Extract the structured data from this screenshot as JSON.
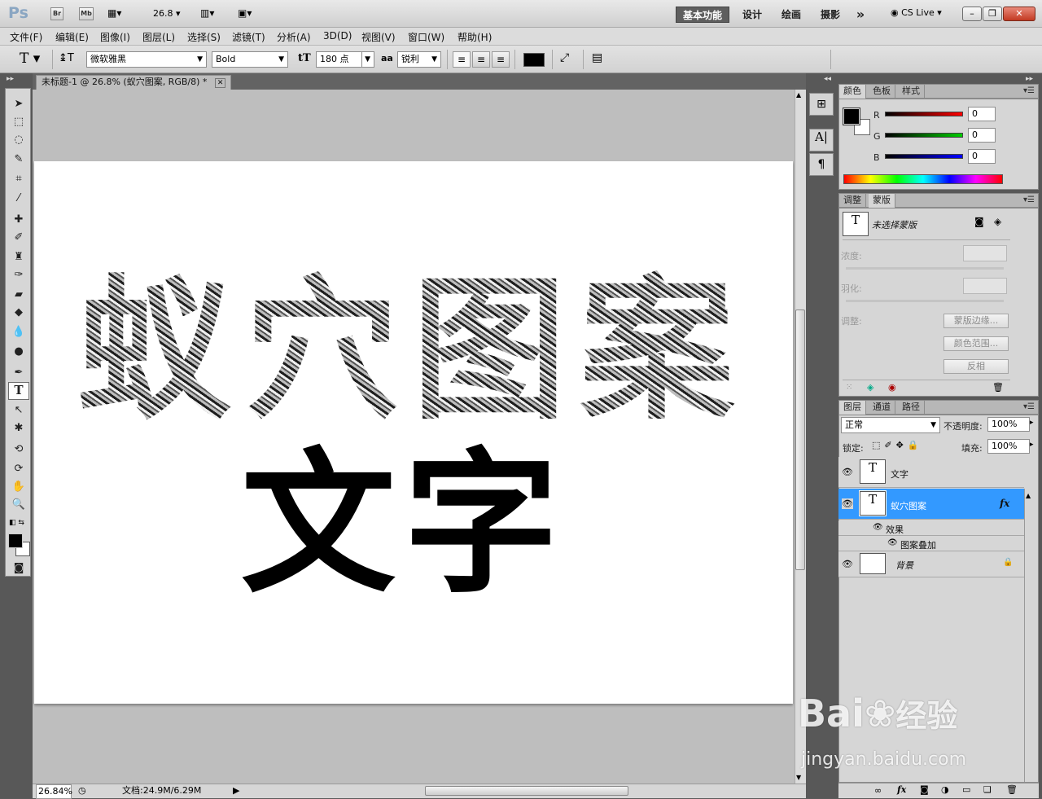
{
  "app": {
    "logo": "Ps",
    "bridge": "Br",
    "minibridge": "Mb",
    "zoom": "26.8",
    "workspaces": [
      "基本功能",
      "设计",
      "绘画",
      "摄影"
    ],
    "more": "»",
    "cslive": "CS Live",
    "win_min": "–",
    "win_max": "❐",
    "win_close": "✕"
  },
  "menu": [
    "文件(F)",
    "编辑(E)",
    "图像(I)",
    "图层(L)",
    "选择(S)",
    "滤镜(T)",
    "分析(A)",
    "3D(D)",
    "视图(V)",
    "窗口(W)",
    "帮助(H)"
  ],
  "options": {
    "tool_icon": "T",
    "font_family": "微软雅黑",
    "font_style": "Bold",
    "size_icon": "tT",
    "font_size": "180 点",
    "aa_icon": "aa",
    "antialias": "锐利",
    "color": "#000000"
  },
  "document": {
    "tab_title": "未标题-1 @ 26.8% (蚁穴图案, RGB/8) *",
    "tab_close": "✕",
    "pattern_text": "蚁穴图案",
    "plain_text": "文字",
    "zoom_status": "26.84%",
    "doc_info": "文档:24.9M/6.29M"
  },
  "color_panel": {
    "tabs": [
      "颜色",
      "色板",
      "样式"
    ],
    "channels": [
      {
        "label": "R",
        "value": "0"
      },
      {
        "label": "G",
        "value": "0"
      },
      {
        "label": "B",
        "value": "0"
      }
    ]
  },
  "masks_panel": {
    "tabs": [
      "调整",
      "蒙版"
    ],
    "no_mask": "未选择蒙版",
    "density": "浓度:",
    "feather": "羽化:",
    "adjust": "调整:",
    "btn_edge": "蒙版边缘...",
    "btn_color": "颜色范围...",
    "btn_invert": "反相"
  },
  "layers_panel": {
    "tabs": [
      "图层",
      "通道",
      "路径"
    ],
    "blend_mode": "正常",
    "opacity_label": "不透明度:",
    "opacity": "100%",
    "lock_label": "锁定:",
    "fill_label": "填充:",
    "fill": "100%",
    "layers": [
      {
        "name": "文字",
        "thumb": "T"
      },
      {
        "name": "蚁穴图案",
        "thumb": "T",
        "fx": "fx"
      },
      {
        "name": "效果"
      },
      {
        "name": "图案叠加"
      },
      {
        "name": "背景"
      }
    ]
  },
  "watermark": {
    "brand": "Bai",
    "brand2": "经验",
    "url": "jingyan.baidu.com"
  }
}
